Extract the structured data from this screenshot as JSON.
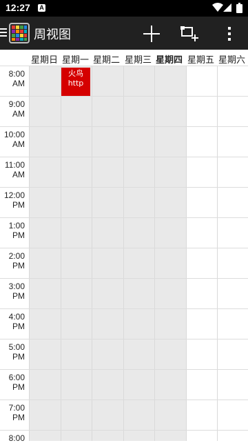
{
  "status": {
    "time": "12:27",
    "notification": "A"
  },
  "toolbar": {
    "title": "周视图"
  },
  "days": [
    {
      "label": "星期日",
      "today": false
    },
    {
      "label": "星期一",
      "today": false
    },
    {
      "label": "星期二",
      "today": false
    },
    {
      "label": "星期三",
      "today": false
    },
    {
      "label": "星期四",
      "today": true
    },
    {
      "label": "星期五",
      "today": false
    },
    {
      "label": "星期六",
      "today": false
    }
  ],
  "hours": [
    {
      "time": "8:00",
      "ampm": "AM"
    },
    {
      "time": "9:00",
      "ampm": "AM"
    },
    {
      "time": "10:00",
      "ampm": "AM"
    },
    {
      "time": "11:00",
      "ampm": "AM"
    },
    {
      "time": "12:00",
      "ampm": "PM"
    },
    {
      "time": "1:00",
      "ampm": "PM"
    },
    {
      "time": "2:00",
      "ampm": "PM"
    },
    {
      "time": "3:00",
      "ampm": "PM"
    },
    {
      "time": "4:00",
      "ampm": "PM"
    },
    {
      "time": "5:00",
      "ampm": "PM"
    },
    {
      "time": "6:00",
      "ampm": "PM"
    },
    {
      "time": "7:00",
      "ampm": "PM"
    },
    {
      "time": "8:00",
      "ampm": ""
    }
  ],
  "event": {
    "line1": "火鸟",
    "line2": "http",
    "color": "#d50000"
  },
  "colors": {
    "toolbar": "#212121",
    "past_day": "#e9e9e9",
    "grid_line": "#dcdcdc"
  }
}
